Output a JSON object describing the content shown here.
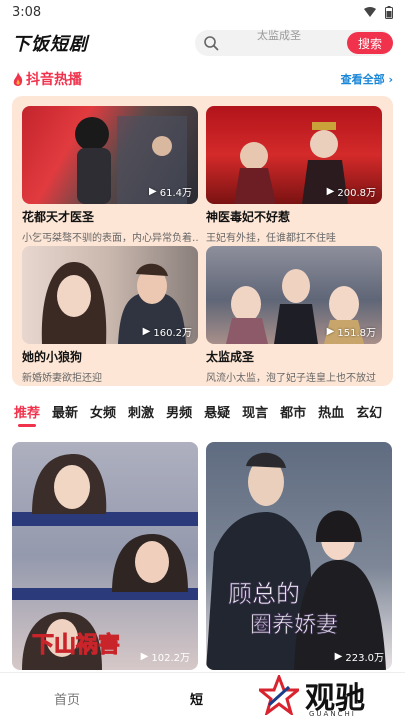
{
  "status": {
    "time": "3:08",
    "icons": [
      "cast-icon",
      "wifi-icon",
      "battery-icon"
    ]
  },
  "header": {
    "title": "下饭短剧",
    "search_placeholder": "太监成圣",
    "search_button": "搜索"
  },
  "hot": {
    "title": "抖音热播",
    "view_all": "查看全部 ›"
  },
  "hot_cards": [
    {
      "title": "花都天才医圣",
      "desc": "小乞丐桀骜不驯的表面，内心异常负着…",
      "count": "61.4万"
    },
    {
      "title": "神医毒妃不好惹",
      "desc": "王妃有外挂，任谁都扛不住哇",
      "count": "200.8万"
    },
    {
      "title": "她的小狼狗",
      "desc": "新婚娇妻欲拒还迎",
      "count": "160.2万"
    },
    {
      "title": "太监成圣",
      "desc": "风流小太监，泡了妃子连皇上也不放过",
      "count": "151.8万"
    }
  ],
  "tabs": [
    "推荐",
    "最新",
    "女频",
    "刺激",
    "男频",
    "悬疑",
    "现言",
    "都市",
    "热血",
    "玄幻"
  ],
  "tiles": [
    {
      "count": "102.2万",
      "poster_text": "下山祸害"
    },
    {
      "count": "223.0万",
      "poster_text": "顾总的圈养娇妻"
    }
  ],
  "nav": {
    "home": "首页",
    "short": "短"
  },
  "watermark": {
    "text": "观驰",
    "sub": "GUANCHI"
  },
  "colors": {
    "accent": "#f1324d",
    "panel": "#fde6d6",
    "link": "#1a87d8"
  }
}
